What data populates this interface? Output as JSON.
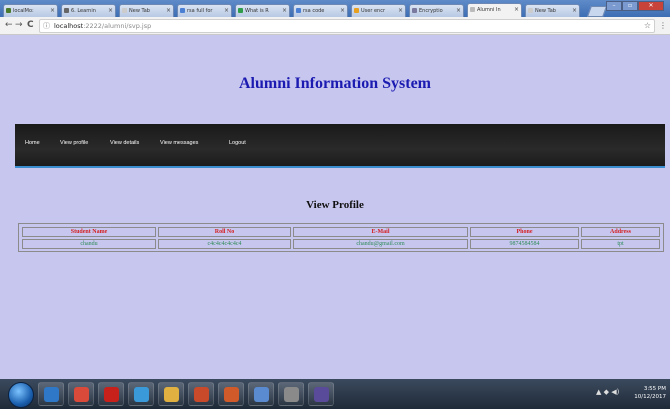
{
  "browser": {
    "tabs": [
      {
        "label": "localMo:",
        "active": false,
        "color": "#4a7a2a"
      },
      {
        "label": "6. Learnin",
        "active": false,
        "color": "#666666"
      },
      {
        "label": "New Tab",
        "active": false,
        "color": "#cccccc"
      },
      {
        "label": "rsa full for",
        "active": false,
        "color": "#4a7fd4"
      },
      {
        "label": "What is R",
        "active": false,
        "color": "#2e9c4a"
      },
      {
        "label": "rsa code",
        "active": false,
        "color": "#4a7fd4"
      },
      {
        "label": "User encr",
        "active": false,
        "color": "#e8a020"
      },
      {
        "label": "Encryptio",
        "active": false,
        "color": "#7a7aa0"
      },
      {
        "label": "Alumni In",
        "active": true,
        "color": "#bbbbbb"
      },
      {
        "label": "New Tab",
        "active": false,
        "color": "#cccccc"
      }
    ],
    "nav": {
      "back": "←",
      "forward": "→",
      "reload": "C"
    },
    "address": {
      "info_icon": "ⓘ",
      "host": "localhost",
      "path": ":2222/alumni/svp.jsp"
    },
    "star": "☆",
    "menu": "⋮"
  },
  "site": {
    "title": "Alumni Information System",
    "nav": [
      "Home",
      "View profile",
      "View details",
      "View messages",
      "Logout"
    ],
    "section_title": "View Profile"
  },
  "table": {
    "headers": [
      "Student Name",
      "Roll No",
      "E-Mail",
      "Phone",
      "Address"
    ],
    "rows": [
      [
        "chandu",
        "c4c4c4c4c4c4",
        "chandu@gmail.com",
        "9874584584",
        "tpt"
      ]
    ]
  },
  "taskbar": {
    "apps": [
      {
        "icon": "windows-explorer-icon",
        "color": "#2f78c8"
      },
      {
        "icon": "chrome-icon",
        "color": "#d94a3a"
      },
      {
        "icon": "acrobat-icon",
        "color": "#c8201a"
      },
      {
        "icon": "ie-icon",
        "color": "#3a9ad9"
      },
      {
        "icon": "folder-icon",
        "color": "#e0b040"
      },
      {
        "icon": "paint-icon",
        "color": "#c84a2a"
      },
      {
        "icon": "powerpoint-icon",
        "color": "#d05a2a"
      },
      {
        "icon": "notepad-icon",
        "color": "#5a8ad0"
      },
      {
        "icon": "settings-icon",
        "color": "#8a8a8a"
      },
      {
        "icon": "eclipse-icon",
        "color": "#5a4a9a"
      }
    ],
    "clock_time": "3:55 PM",
    "clock_date": "10/12/2017",
    "tray": "▲ ◆ ◀)"
  }
}
